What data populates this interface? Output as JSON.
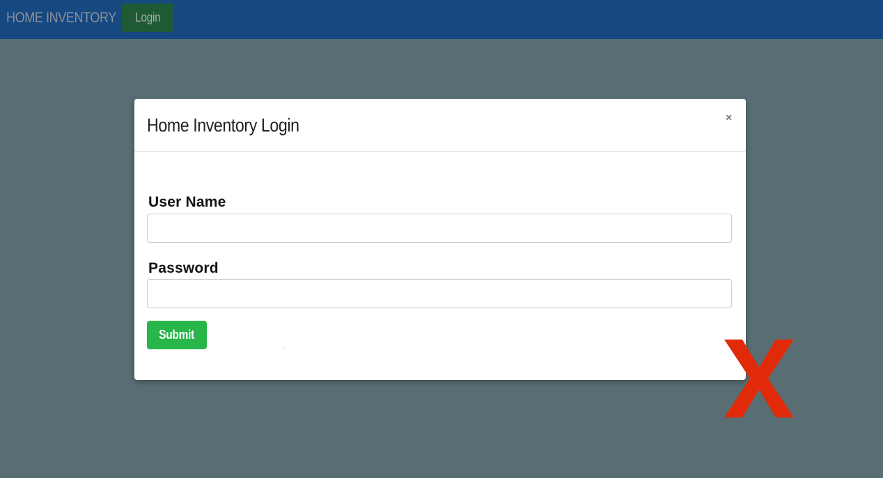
{
  "navbar": {
    "brand": "HOME INVENTORY",
    "login_label": "Login",
    "background_color": "#164882",
    "login_button_color": "#1e5a34"
  },
  "modal": {
    "title": "Home Inventory Login",
    "close_symbol": "×",
    "fields": [
      {
        "label": "User Name",
        "value": "",
        "placeholder": ""
      },
      {
        "label": "Password",
        "value": "",
        "placeholder": ""
      }
    ],
    "submit_label": "Submit",
    "submit_color": "#28b54a"
  },
  "overlay": {
    "mark_icon": "red-x-icon",
    "mark_color": "#e02a0a"
  },
  "backdrop_color": "#596e73"
}
